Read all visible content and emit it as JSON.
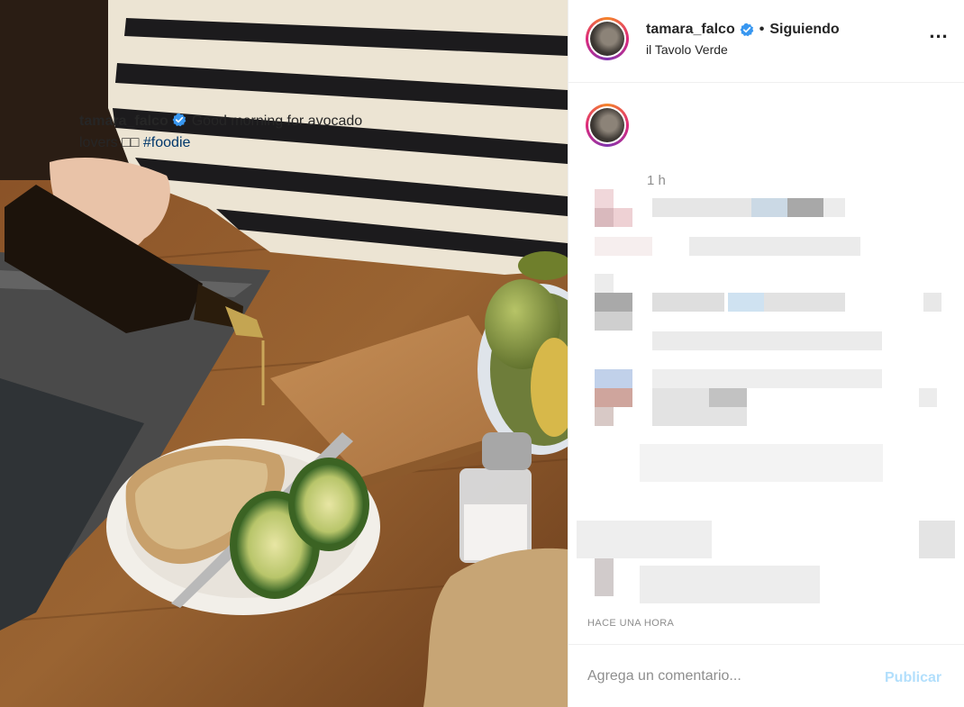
{
  "header": {
    "username": "tamara_falco",
    "separator": "•",
    "follow_status": "Siguiendo",
    "location": "il Tavolo Verde",
    "more_label": "..."
  },
  "caption": {
    "username": "tamara_falco",
    "text": "Good morning for avocado lovers □□",
    "hashtag": "#foodie",
    "time_ago": "1 h"
  },
  "post_meta": {
    "posted_label": "HACE UNA HORA"
  },
  "comment_bar": {
    "placeholder": "Agrega un comentario...",
    "publish_label": "Publicar"
  },
  "colors": {
    "verified_blue": "#3897f0",
    "hashtag_blue": "#00376b",
    "muted_gray": "#8e8e8e",
    "publish_disabled": "#b2dffc"
  },
  "icons": {
    "verified": "verified-badge-icon",
    "more": "more-options-icon"
  }
}
